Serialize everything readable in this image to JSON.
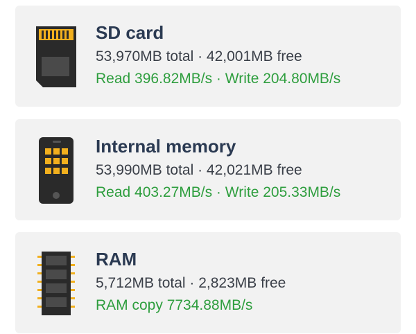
{
  "colors": {
    "title": "#2b3a52",
    "detail": "#3a3f48",
    "speed": "#2e9e3e",
    "card_bg": "#f2f2f2",
    "icon_dark": "#2a2a2a",
    "icon_accent": "#f2b01e"
  },
  "storage_items": [
    {
      "icon": "sd-card-icon",
      "title": "SD card",
      "capacity": "53,970MB total · 42,001MB free",
      "speed": "Read 396.82MB/s · Write 204.80MB/s"
    },
    {
      "icon": "phone-memory-icon",
      "title": "Internal memory",
      "capacity": "53,990MB total · 42,021MB free",
      "speed": "Read 403.27MB/s · Write 205.33MB/s"
    },
    {
      "icon": "ram-chip-icon",
      "title": "RAM",
      "capacity": "5,712MB total · 2,823MB free",
      "speed": "RAM copy 7734.88MB/s"
    }
  ]
}
